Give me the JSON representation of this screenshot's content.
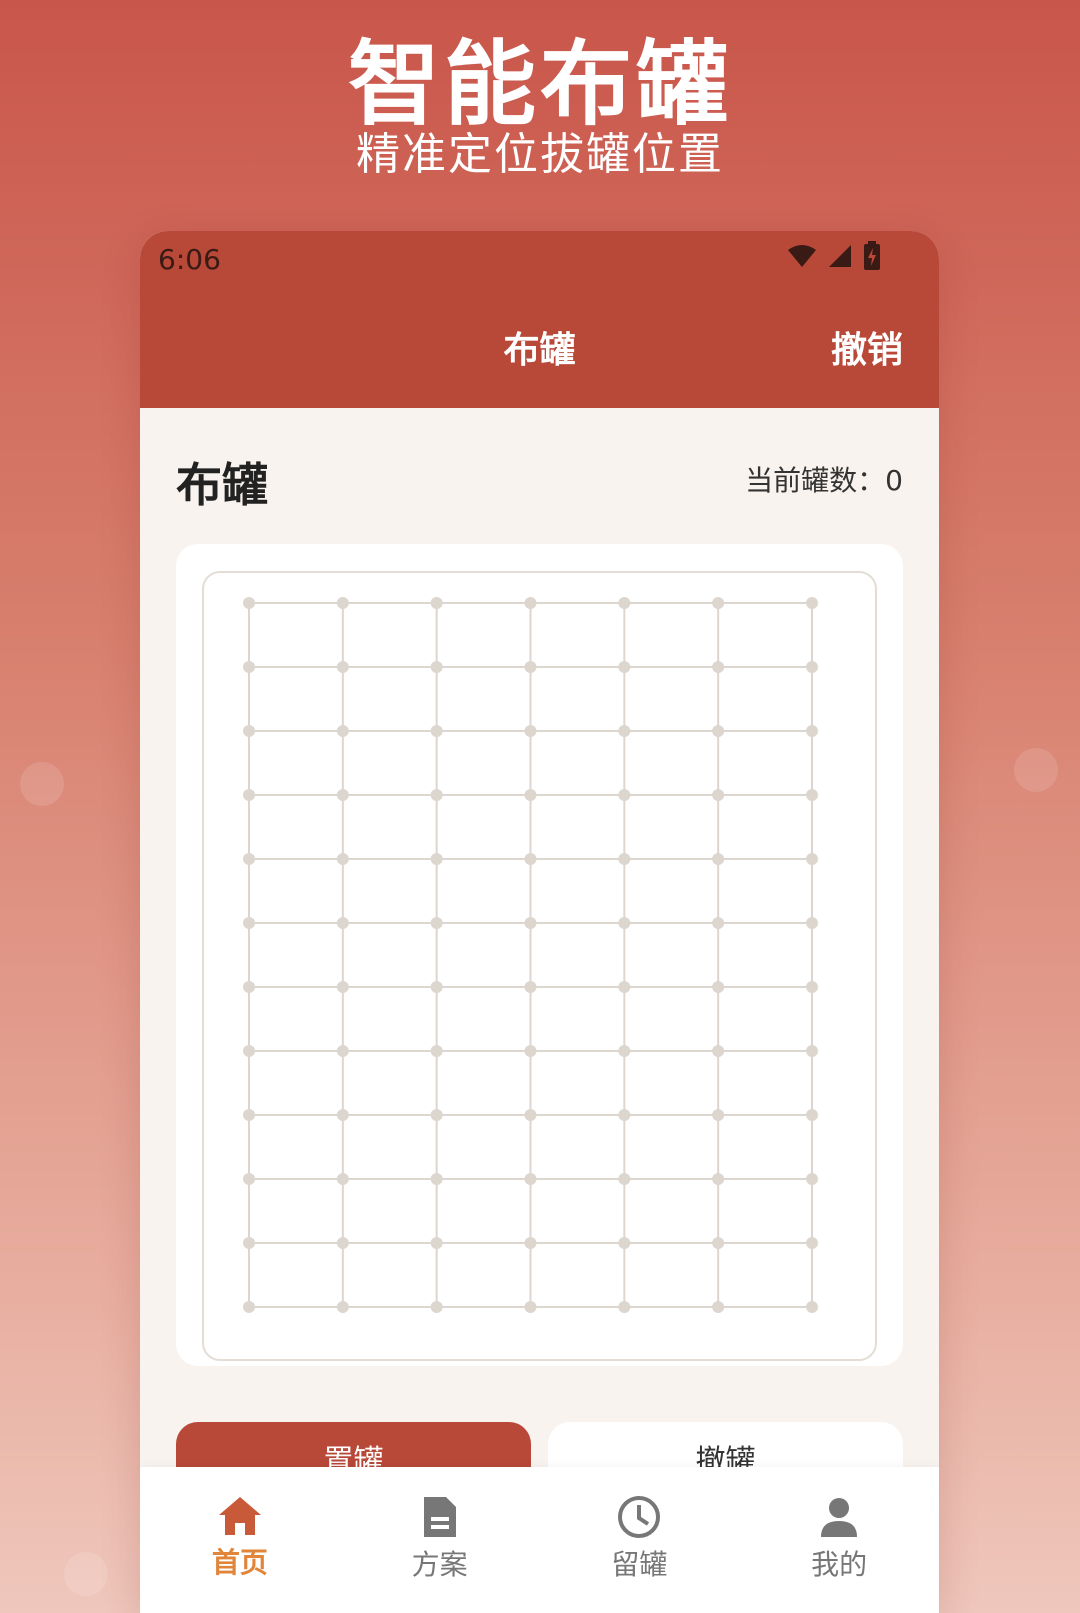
{
  "promo": {
    "title": "智能布罐",
    "subtitle": "精准定位拔罐位置"
  },
  "status_bar": {
    "time": "6:06",
    "icons": [
      "wifi-icon",
      "signal-icon",
      "battery-charging-icon"
    ]
  },
  "app_bar": {
    "title": "布罐",
    "action": "撤销"
  },
  "section": {
    "title": "布罐",
    "count_label": "当前罐数：0"
  },
  "board": {
    "columns": 7,
    "rows": 12
  },
  "buttons": {
    "place": "置罐",
    "undo": "撤罐"
  },
  "bottom_nav": {
    "items": [
      {
        "label": "首页",
        "icon": "home-icon",
        "active": true
      },
      {
        "label": "方案",
        "icon": "document-icon",
        "active": false
      },
      {
        "label": "留罐",
        "icon": "clock-icon",
        "active": false
      },
      {
        "label": "我的",
        "icon": "user-icon",
        "active": false
      }
    ]
  },
  "colors": {
    "primary": "#b84838",
    "accent": "#e0853a",
    "background": "#f8f3ee",
    "grid": "#dcd6cf"
  }
}
